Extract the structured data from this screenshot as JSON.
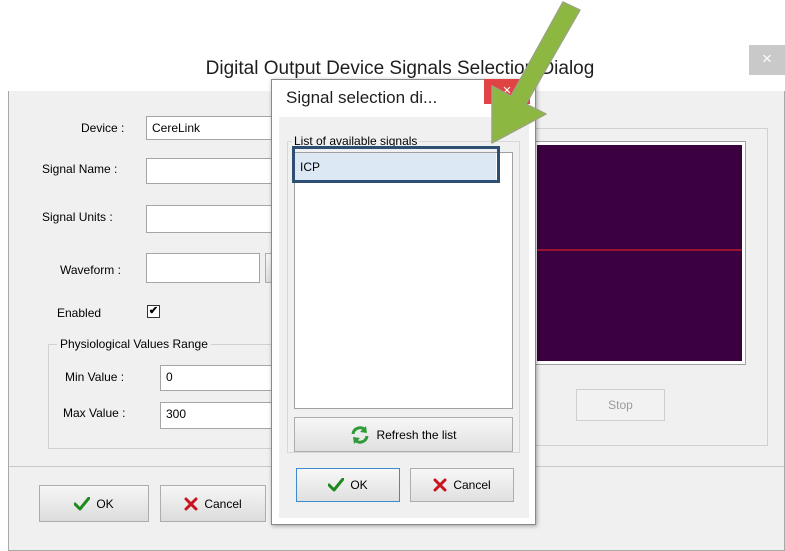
{
  "main_dialog": {
    "title": "Digital Output Device Signals Selection Dialog",
    "close_icon": "×",
    "device_label": "Device :",
    "device_value": "CereLink",
    "signal_name_label": "Signal Name :",
    "signal_name_value": "",
    "signal_units_label": "Signal Units :",
    "signal_units_value": "",
    "waveform_label": "Waveform :",
    "waveform_value": "",
    "enabled_label": "Enabled",
    "enabled_checked": true,
    "checkmark": "✔",
    "range_group_label": "Physiological Values Range",
    "min_label": "Min Value :",
    "min_value": "0",
    "max_label": "Max Value :",
    "max_value": "300",
    "stop_label": "Stop",
    "ok_label": "OK",
    "cancel_label": "Cancel"
  },
  "signal_dialog": {
    "title": "Signal selection di...",
    "close_icon": "×",
    "list_label": "List of available signals",
    "signals": [
      "ICP"
    ],
    "refresh_label": "Refresh the list",
    "ok_label": "OK",
    "cancel_label": "Cancel"
  },
  "colors": {
    "preview_bg": "#3b0040",
    "preview_line": "#d4202a",
    "highlight_border": "#2d4f73",
    "arrow_green": "#8cb842",
    "ok_check": "#1e8a1e",
    "cancel_x": "#c8141e",
    "close_red": "#e04343"
  },
  "icons": {
    "ok": "check-icon",
    "cancel": "x-icon",
    "refresh": "refresh-icon",
    "annotation": "arrow-down-left-icon"
  }
}
